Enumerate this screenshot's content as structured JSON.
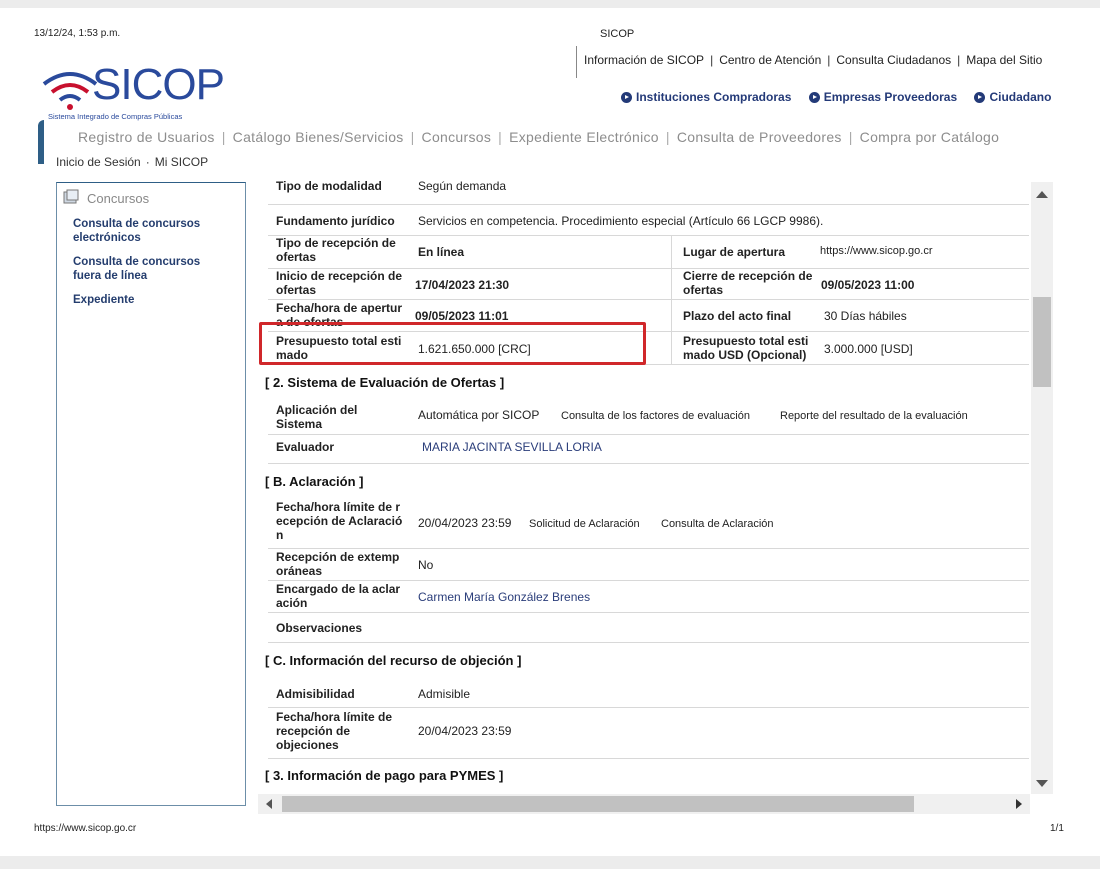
{
  "print_header": {
    "datetime": "13/12/24, 1:53 p.m.",
    "title": "SICOP"
  },
  "print_footer": {
    "url": "https://www.sicop.go.cr",
    "page": "1/1"
  },
  "logo": {
    "name": "SICOP",
    "subtitle": "Sistema Integrado de Compras Públicas"
  },
  "top_links": [
    "Información de SICOP",
    "Centro de Atención",
    "Consulta Ciudadanos",
    "Mapa del Sitio"
  ],
  "sub_nav": [
    "Instituciones Compradoras",
    "Empresas Proveedoras",
    "Ciudadano"
  ],
  "main_nav": [
    "Registro de Usuarios",
    "Catálogo Bienes/Servicios",
    "Concursos",
    "Expediente Electrónico",
    "Consulta de Proveedores",
    "Compra por Catálogo"
  ],
  "session_links": [
    "Inicio de Sesión",
    "Mi SICOP"
  ],
  "left_panel": {
    "title": "Concursos",
    "links": [
      [
        "Consulta de concursos",
        "electrónicos"
      ],
      [
        "Consulta de concursos",
        "fuera de línea"
      ],
      [
        "Expediente"
      ]
    ]
  },
  "section1": {
    "tipo_modalidad": {
      "label": "Tipo de modalidad",
      "value": "Según demanda"
    },
    "fundamento": {
      "label": "Fundamento jurídico",
      "value": "Servicios en competencia. Procedimiento especial (Artículo 66 LGCP 9986)."
    },
    "tipo_recepcion": {
      "label": [
        "Tipo de recepción de",
        "ofertas"
      ],
      "value": "En línea"
    },
    "lugar_apertura": {
      "label": "Lugar de apertura",
      "value": "https://www.sicop.go.cr"
    },
    "inicio_recepcion": {
      "label": [
        "Inicio de recepción de",
        "ofertas"
      ],
      "value": "17/04/2023 21:30"
    },
    "cierre_recepcion": {
      "label": [
        "Cierre de recepción de",
        "ofertas"
      ],
      "value": "09/05/2023 11:00"
    },
    "fecha_apertura": {
      "label": [
        "Fecha/hora de apertur",
        "a de ofertas"
      ],
      "value": "09/05/2023 11:01"
    },
    "plazo_acto": {
      "label": "Plazo del acto final",
      "value": "30 Días hábiles"
    },
    "presupuesto": {
      "label": [
        "Presupuesto total esti",
        "mado"
      ],
      "value": "1.621.650.000 [CRC]"
    },
    "presupuesto_usd": {
      "label": [
        "Presupuesto total esti",
        "mado USD (Opcional)"
      ],
      "value": "3.000.000 [USD]"
    }
  },
  "section2": {
    "title": "[ 2. Sistema de Evaluación de Ofertas ]",
    "aplicacion": {
      "label": [
        "Aplicación del",
        "Sistema"
      ],
      "value": "Automática por SICOP",
      "link1": "Consulta de los factores de evaluación",
      "link2": "Reporte del resultado de la evaluación"
    },
    "evaluador": {
      "label": "Evaluador",
      "value": "MARIA JACINTA SEVILLA LORIA"
    }
  },
  "sectionB": {
    "title": "[ B. Aclaración ]",
    "fecha_limite": {
      "label": [
        "Fecha/hora límite de r",
        "ecepción de Aclaració",
        "n"
      ],
      "value": "20/04/2023 23:59",
      "link1": "Solicitud de Aclaración",
      "link2": "Consulta de Aclaración"
    },
    "recepcion_ext": {
      "label": [
        "Recepción de extemp",
        "oráneas"
      ],
      "value": "No"
    },
    "encargado": {
      "label": [
        "Encargado de la aclar",
        "ación"
      ],
      "value": "Carmen María González Brenes"
    },
    "observaciones": {
      "label": "Observaciones",
      "value": ""
    }
  },
  "sectionC": {
    "title": "[ C. Información del recurso de objeción ]",
    "admisibilidad": {
      "label": "Admisibilidad",
      "value": "Admisible"
    },
    "fecha_objeciones": {
      "label": [
        "Fecha/hora límite de",
        "recepción de",
        "objeciones"
      ],
      "value": "20/04/2023 23:59"
    }
  },
  "section3": {
    "title": "[ 3. Información de pago para PYMES ]"
  },
  "colors": {
    "brand_blue": "#233a78",
    "highlight_red": "#d0272a",
    "wifi_red": "#c8102e"
  }
}
